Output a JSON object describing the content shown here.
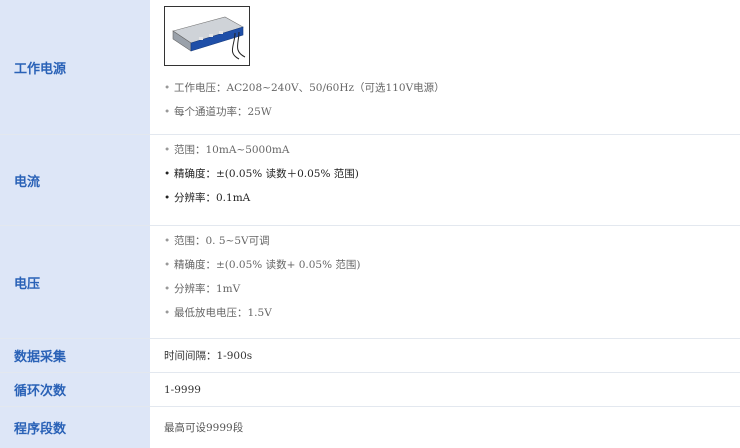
{
  "rows": [
    {
      "label": "工作电源",
      "bullets": [
        "工作电压：AC208~240V、50/60Hz（可选110V电源）",
        "每个通道功率：25W"
      ]
    },
    {
      "label": "电流",
      "bullets": [
        "范围：10mA~5000mA",
        "精确度：±(0.05% 读数＋0.05% 范围)",
        "分辨率：0.1mA"
      ]
    },
    {
      "label": "电压",
      "bullets": [
        "范围：0. 5~5V可调",
        "精确度：±(0.05% 读数+ 0.05% 范围)",
        "分辨率：1mV",
        "最低放电电压：1.5V"
      ]
    },
    {
      "label": "数据采集",
      "value": "时间间隔：1-900s"
    },
    {
      "label": "循环次数",
      "value": "1-9999"
    },
    {
      "label": "程序段数",
      "value": "最高可设9999段"
    }
  ],
  "colors": {
    "label_bg": "#dde6f7",
    "label_text": "#2a62b7",
    "device_body": "#1f4fa8"
  },
  "icons": {
    "product": "battery-tester-device-image"
  }
}
